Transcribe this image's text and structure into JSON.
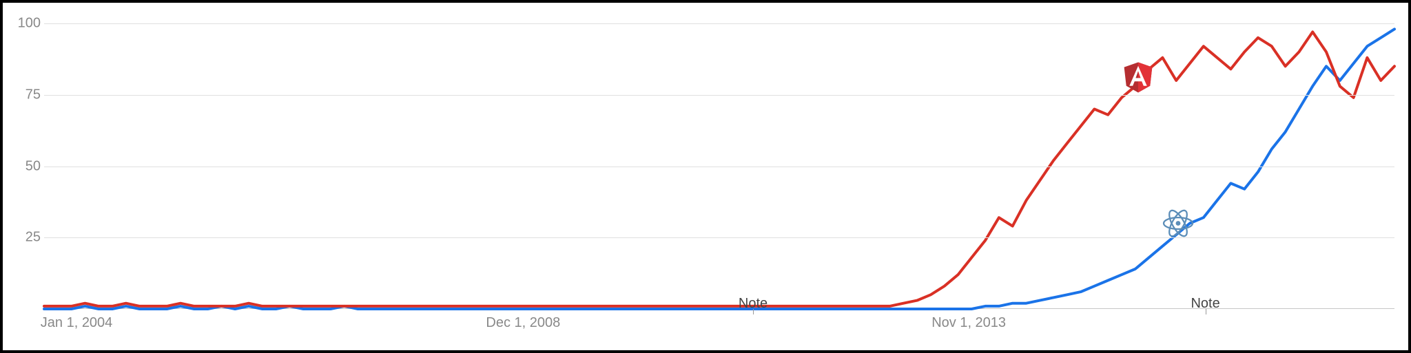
{
  "chart_data": {
    "type": "line",
    "title": "",
    "xlabel": "",
    "ylabel": "",
    "ylim": [
      0,
      100
    ],
    "y_ticks": [
      25,
      50,
      75,
      100
    ],
    "x_tick_labels": [
      {
        "pos": 0.0,
        "label": "Jan 1, 2004"
      },
      {
        "pos": 0.33,
        "label": "Dec 1, 2008"
      },
      {
        "pos": 0.66,
        "label": "Nov 1, 2013"
      }
    ],
    "annotations": [
      {
        "pos": 0.525,
        "label": "Note"
      },
      {
        "pos": 0.86,
        "label": "Note"
      }
    ],
    "series": [
      {
        "name": "Angular",
        "color": "#d93025",
        "icon": "angular-icon",
        "icon_at": 0.81,
        "values": [
          1,
          1,
          1,
          2,
          1,
          1,
          2,
          1,
          1,
          1,
          2,
          1,
          1,
          1,
          1,
          2,
          1,
          1,
          1,
          1,
          1,
          1,
          1,
          1,
          1,
          1,
          1,
          1,
          1,
          1,
          1,
          1,
          1,
          1,
          1,
          1,
          1,
          1,
          1,
          1,
          1,
          1,
          1,
          1,
          1,
          1,
          1,
          1,
          1,
          1,
          1,
          1,
          1,
          1,
          1,
          1,
          1,
          1,
          1,
          1,
          1,
          1,
          1,
          2,
          3,
          5,
          8,
          12,
          18,
          24,
          32,
          29,
          38,
          45,
          52,
          58,
          64,
          70,
          68,
          74,
          78,
          84,
          88,
          80,
          86,
          92,
          88,
          84,
          90,
          95,
          92,
          85,
          90,
          97,
          90,
          78,
          74,
          88,
          80,
          85
        ]
      },
      {
        "name": "React",
        "color": "#1a73e8",
        "icon": "react-icon",
        "icon_at": 0.84,
        "values": [
          0,
          0,
          0,
          1,
          0,
          0,
          1,
          0,
          0,
          0,
          1,
          0,
          0,
          1,
          0,
          1,
          0,
          0,
          1,
          0,
          0,
          0,
          1,
          0,
          0,
          0,
          0,
          0,
          0,
          0,
          0,
          0,
          0,
          0,
          0,
          0,
          0,
          0,
          0,
          0,
          0,
          0,
          0,
          0,
          0,
          0,
          0,
          0,
          0,
          0,
          0,
          0,
          0,
          0,
          0,
          0,
          0,
          0,
          0,
          0,
          0,
          0,
          0,
          0,
          0,
          0,
          0,
          0,
          0,
          1,
          1,
          2,
          2,
          3,
          4,
          5,
          6,
          8,
          10,
          12,
          14,
          18,
          22,
          26,
          30,
          32,
          38,
          44,
          42,
          48,
          56,
          62,
          70,
          78,
          85,
          80,
          86,
          92,
          95,
          98
        ]
      }
    ]
  }
}
